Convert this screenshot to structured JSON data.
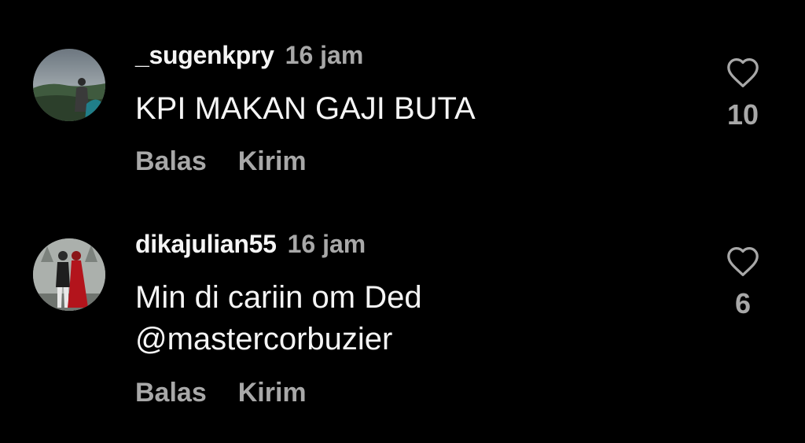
{
  "comments": [
    {
      "username": "_sugenkpry",
      "time": "16 jam",
      "text": "KPI MAKAN GAJI BUTA",
      "reply_label": "Balas",
      "send_label": "Kirim",
      "like_count": "10",
      "like_icon": "heart-outline-icon"
    },
    {
      "username": "dikajulian55",
      "time": "16 jam",
      "text": "Min di cariin om Ded\n@mastercorbuzier",
      "reply_label": "Balas",
      "send_label": "Kirim",
      "like_count": "6",
      "like_icon": "heart-outline-icon"
    }
  ],
  "colors": {
    "background": "#000000",
    "primary_text": "#f5f5f5",
    "secondary_text": "#a8a8a8"
  }
}
